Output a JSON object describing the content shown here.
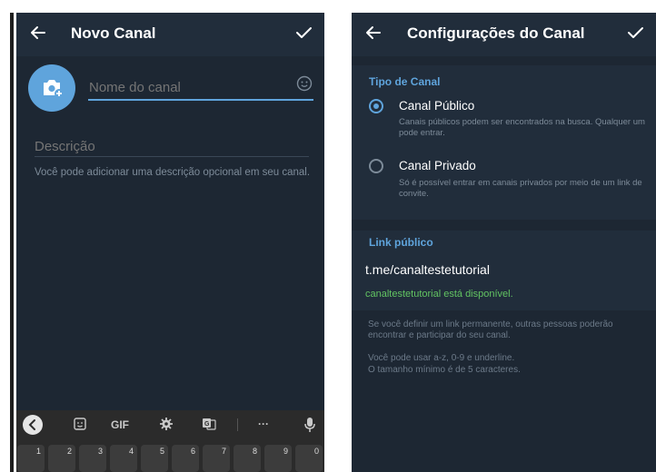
{
  "colors": {
    "background": "#1d2733",
    "appbar": "#212d3b",
    "accent": "#5fa4dc",
    "available": "#62c462",
    "hint_text": "#7d8b99"
  },
  "left_screen": {
    "appbar": {
      "title": "Novo Canal",
      "back_icon": "arrow-left-icon",
      "confirm_icon": "check-icon"
    },
    "avatar_icon": "camera-add-icon",
    "name_field": {
      "placeholder": "Nome do canal",
      "emoji_icon": "smiley-icon"
    },
    "description_field": {
      "placeholder": "Descrição"
    },
    "description_hint": "Você pode adicionar uma descrição opcional em seu canal.",
    "keyboard": {
      "toolbar": [
        {
          "name": "sticker",
          "label": ""
        },
        {
          "name": "gif",
          "label": "GIF"
        },
        {
          "name": "settings",
          "label": ""
        },
        {
          "name": "translate",
          "label": ""
        },
        {
          "name": "more",
          "label": "···"
        }
      ],
      "number_row": [
        "1",
        "2",
        "3",
        "4",
        "5",
        "6",
        "7",
        "8",
        "9",
        "0"
      ]
    }
  },
  "right_screen": {
    "appbar": {
      "title": "Configurações do Canal",
      "back_icon": "arrow-left-icon",
      "confirm_icon": "check-icon"
    },
    "channel_type": {
      "header": "Tipo de Canal",
      "options": [
        {
          "title": "Canal Público",
          "description": "Canais públicos podem ser encontrados na busca. Qualquer um pode entrar.",
          "selected": true
        },
        {
          "title": "Canal Privado",
          "description": "Só é possível entrar em canais privados por meio de um link de convite.",
          "selected": false
        }
      ]
    },
    "public_link": {
      "header": "Link público",
      "value": "t.me/canaltestetutorial",
      "status": "canaltestetutorial está disponível.",
      "info_1": "Se você definir um link permanente, outras pessoas poderão encontrar e participar do seu canal.",
      "info_2": "Você pode usar a-z, 0-9 e underline.",
      "info_3": "O tamanho mínimo é de 5 caracteres."
    }
  }
}
